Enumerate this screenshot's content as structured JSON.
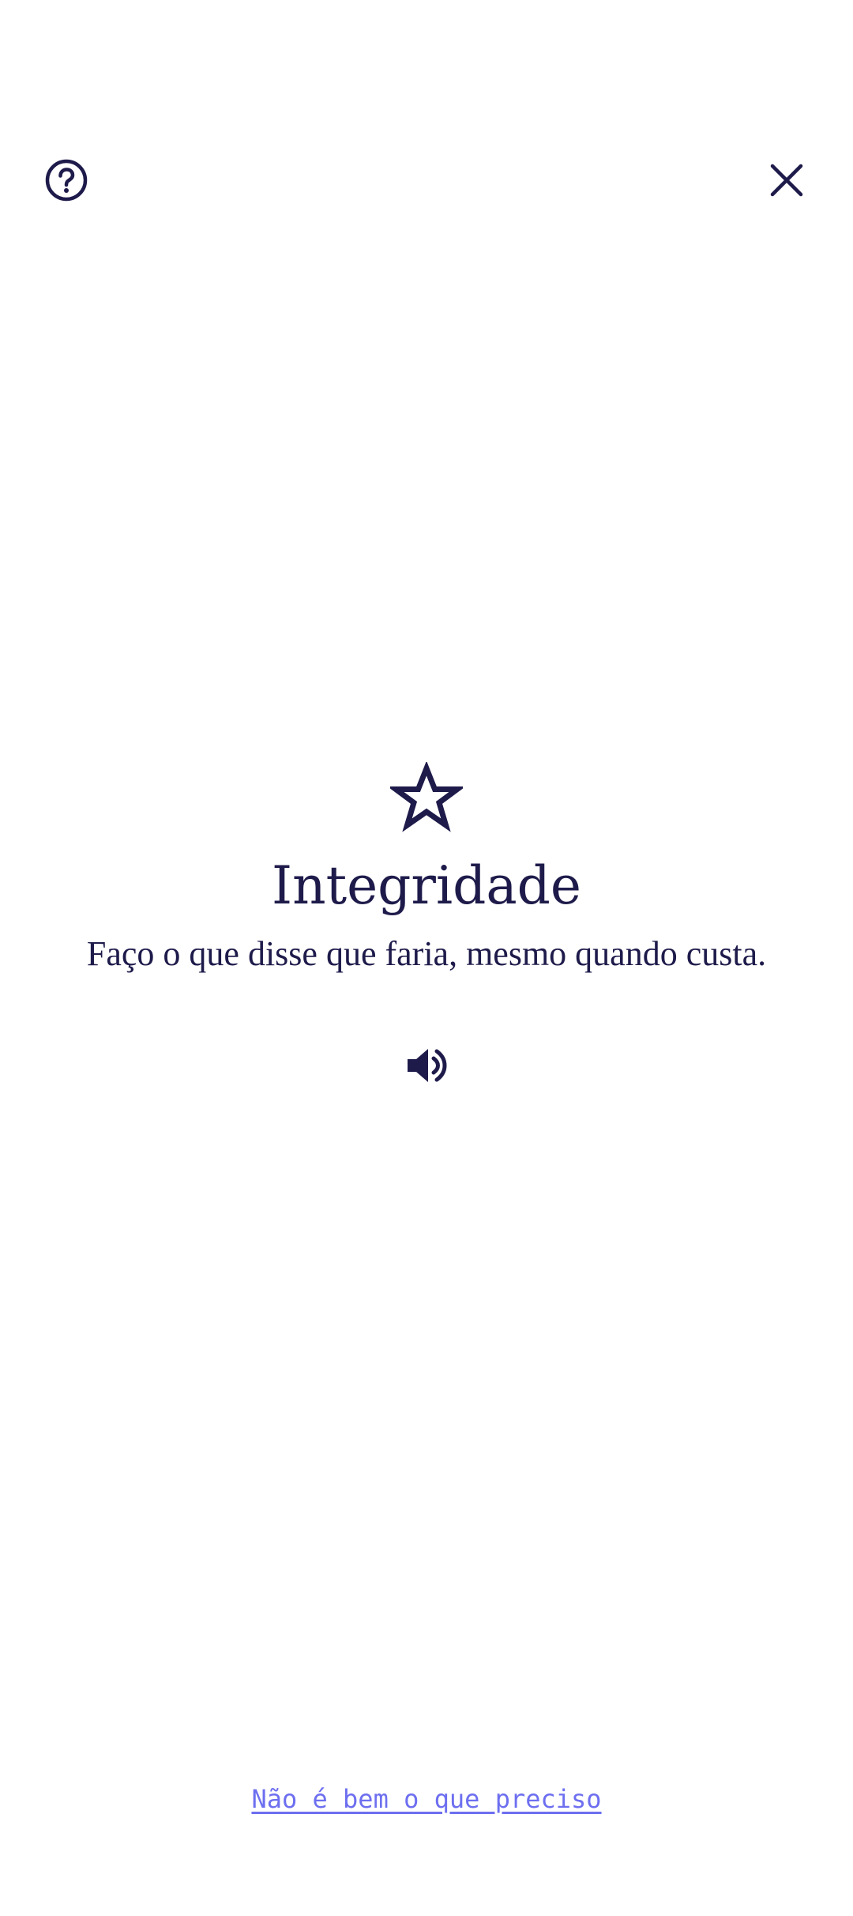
{
  "header": {
    "help_icon": "help-circle-icon",
    "close_icon": "close-icon"
  },
  "value_card": {
    "icon": "star-outline-icon",
    "title": "Integridade",
    "description": "Faço o que disse que faria, mesmo quando custa.",
    "audio_icon": "speaker-volume-icon"
  },
  "footer": {
    "link_label": "Não é bem o que preciso"
  },
  "colors": {
    "primary": "#1e1b4b",
    "link": "#6d6ff0",
    "background": "#ffffff"
  }
}
